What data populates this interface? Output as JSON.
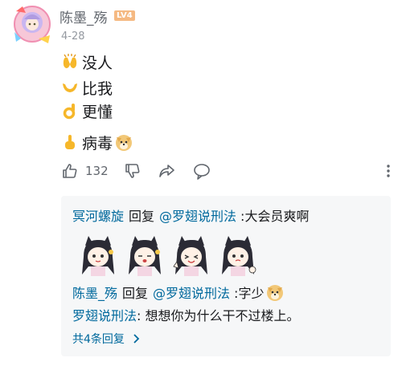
{
  "comment": {
    "username": "陈墨_殇",
    "level_badge": "LV4",
    "date": "4-28",
    "lines": [
      "没人",
      "比我",
      "更懂",
      "病毒"
    ],
    "like_count": "132"
  },
  "reply_panel": {
    "reply1": {
      "user": "冥河螺旋",
      "verb": "回复",
      "mention": "@罗翅说刑法",
      "text": ":大会员爽啊"
    },
    "reply2": {
      "user": "陈墨_殇",
      "verb": "回复",
      "mention": "@罗翅说刑法",
      "text": ":字少"
    },
    "reply3": {
      "user": "罗翅说刑法",
      "text": ": 想想你为什么干不过楼上。"
    },
    "total_label": "共4条回复"
  },
  "colors": {
    "link_blue": "#00699d",
    "username_gray": "#61666d",
    "badge_orange": "#f5b982",
    "panel_bg": "#f6f7f8"
  },
  "icons": [
    "avatar-frame",
    "clap-emoji",
    "hands-emoji",
    "ok-hand-emoji",
    "point-up-emoji",
    "doge-icon",
    "thumbs-up-icon",
    "thumbs-down-icon",
    "share-icon",
    "reply-bubble-icon",
    "more-vertical-icon",
    "anime-cat-girl-sticker",
    "chevron-right-icon"
  ]
}
